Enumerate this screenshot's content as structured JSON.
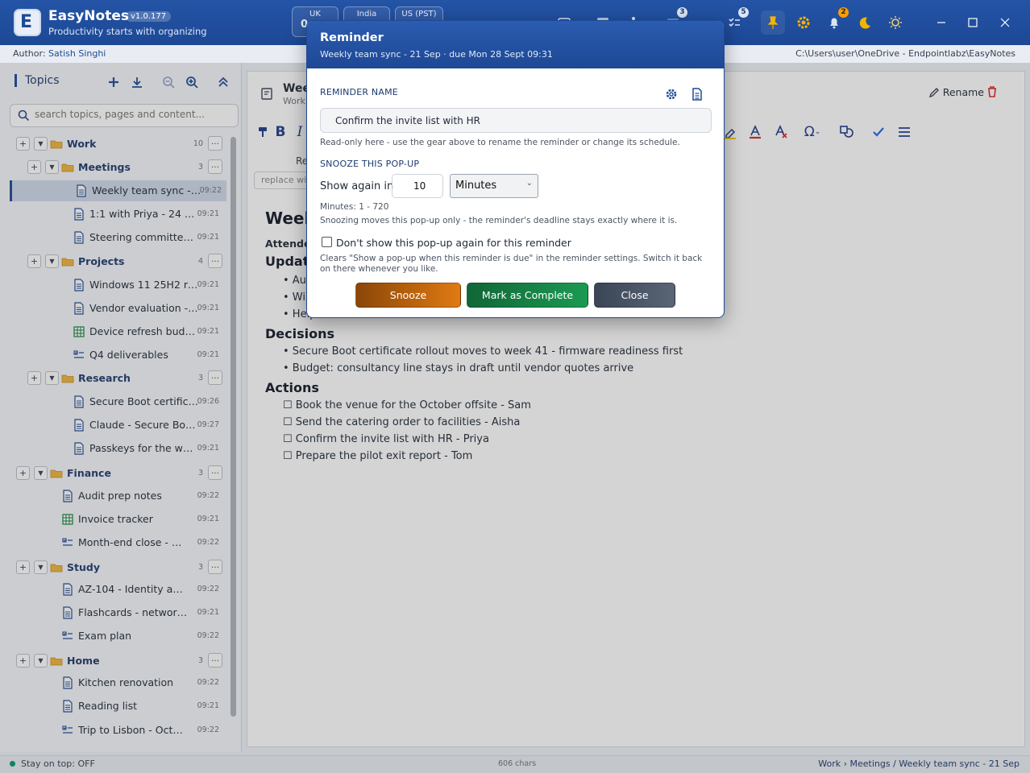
{
  "app": {
    "name": "EasyNotes",
    "version": "v1.0.177",
    "tagline": "Productivity starts with organizing",
    "logo_letter": "E"
  },
  "clocks": [
    {
      "label": "UK",
      "time": "0"
    },
    {
      "label": "India",
      "time": ""
    },
    {
      "label": "US (PST)",
      "time": ""
    }
  ],
  "toolbar_badges": {
    "calendar": "3",
    "tasks": "5",
    "alarm": "2"
  },
  "authorbar": {
    "label": "Author:",
    "author": "Satish Singhi",
    "path": "C:\\Users\\user\\OneDrive - Endpointlabz\\EasyNotes"
  },
  "sidebar": {
    "title": "Topics",
    "search_placeholder": "search topics, pages and content...",
    "tree": [
      {
        "type": "folder",
        "label": "Work",
        "count": "10",
        "level": 0
      },
      {
        "type": "folder",
        "label": "Meetings",
        "count": "3",
        "level": 1
      },
      {
        "type": "page",
        "label": "Weekly team sync - 21...",
        "time": "09:22",
        "level": 2,
        "selected": true,
        "icon": "doc"
      },
      {
        "type": "page",
        "label": "1:1 with Priya - 24 Sep",
        "time": "09:21",
        "level": 2,
        "icon": "doc"
      },
      {
        "type": "page",
        "label": "Steering committee - Q...",
        "time": "09:21",
        "level": 2,
        "icon": "doc"
      },
      {
        "type": "folder",
        "label": "Projects",
        "count": "4",
        "level": 1
      },
      {
        "type": "page",
        "label": "Windows 11 25H2 rollout",
        "time": "09:21",
        "level": 2,
        "icon": "doc"
      },
      {
        "type": "page",
        "label": "Vendor evaluation - MD...",
        "time": "09:21",
        "level": 2,
        "icon": "doc"
      },
      {
        "type": "page",
        "label": "Device refresh budget 2...",
        "time": "09:21",
        "level": 2,
        "icon": "grid"
      },
      {
        "type": "page",
        "label": "Q4 deliverables",
        "time": "09:21",
        "level": 2,
        "icon": "list"
      },
      {
        "type": "folder",
        "label": "Research",
        "count": "3",
        "level": 1
      },
      {
        "type": "page",
        "label": "Secure Boot certificate...",
        "time": "09:26",
        "level": 2,
        "icon": "doc"
      },
      {
        "type": "page",
        "label": "Claude - Secure Boot c...",
        "time": "09:27",
        "level": 2,
        "icon": "doc"
      },
      {
        "type": "page",
        "label": "Passkeys for the workfo...",
        "time": "09:21",
        "level": 2,
        "icon": "doc"
      },
      {
        "type": "folder",
        "label": "Finance",
        "count": "3",
        "level": 0
      },
      {
        "type": "page",
        "label": "Audit prep notes",
        "time": "09:22",
        "level": 1,
        "icon": "doc"
      },
      {
        "type": "page",
        "label": "Invoice tracker",
        "time": "09:21",
        "level": 1,
        "icon": "grid"
      },
      {
        "type": "page",
        "label": "Month-end close - Septe...",
        "time": "09:22",
        "level": 1,
        "icon": "list"
      },
      {
        "type": "folder",
        "label": "Study",
        "count": "3",
        "level": 0
      },
      {
        "type": "page",
        "label": "AZ-104 - Identity and gov...",
        "time": "09:22",
        "level": 1,
        "icon": "doc"
      },
      {
        "type": "page",
        "label": "Flashcards - networking",
        "time": "09:21",
        "level": 1,
        "icon": "doc"
      },
      {
        "type": "page",
        "label": "Exam plan",
        "time": "09:22",
        "level": 1,
        "icon": "list"
      },
      {
        "type": "folder",
        "label": "Home",
        "count": "3",
        "level": 0
      },
      {
        "type": "page",
        "label": "Kitchen renovation",
        "time": "09:22",
        "level": 1,
        "icon": "doc"
      },
      {
        "type": "page",
        "label": "Reading list",
        "time": "09:21",
        "level": 1,
        "icon": "doc"
      },
      {
        "type": "page",
        "label": "Trip to Lisbon - October",
        "time": "09:22",
        "level": 1,
        "icon": "list"
      }
    ]
  },
  "editor": {
    "title": "Wee",
    "subtitle": "Work",
    "rename_label": "Rename",
    "find_placeholder": "replace with",
    "re_label": "Re",
    "doc": {
      "h1": "Week",
      "attendees": "Attendee",
      "updates_heading": "Update",
      "updates": [
        "• Aut",
        "• Wir",
        "• Help"
      ],
      "decisions_heading": "Decisions",
      "decisions": [
        "• Secure Boot certificate rollout moves to week 41 - firmware readiness first",
        "• Budget: consultancy line stays in draft until vendor quotes arrive"
      ],
      "actions_heading": "Actions",
      "actions": [
        "☐ Book the venue for the October offsite - Sam",
        "☐ Send the catering order to facilities - Aisha",
        "☐ Confirm the invite list with HR - Priya",
        "☐ Prepare the pilot exit report - Tom"
      ]
    }
  },
  "statusbar": {
    "stay_on_top": "Stay on top: OFF",
    "chars": "606 chars",
    "breadcrumb": "Work › Meetings / Weekly team sync - 21 Sep"
  },
  "modal": {
    "title": "Reminder",
    "subtitle": "Weekly team sync - 21 Sep  ·  due Mon 28 Sept 09:31",
    "name_section": "REMINDER NAME",
    "name_value": "Confirm the invite list with HR",
    "name_help": "Read-only here - use the gear above to rename the reminder or change its schedule.",
    "snooze_section": "SNOOZE THIS POP-UP",
    "show_again_label": "Show again in",
    "snooze_value": "10",
    "unit_value": "Minutes",
    "range_help": "Minutes: 1 - 720",
    "snooze_help": "Snoozing moves this pop-up only - the reminder's deadline stays exactly where it is.",
    "dont_show_label": "Don't show this pop-up again for this reminder",
    "dont_show_help": "Clears \"Show a pop-up when this reminder is due\" in the reminder settings. Switch it back on there whenever you like.",
    "snooze_button": "Snooze",
    "complete_button": "Mark as Complete",
    "close_button": "Close"
  }
}
